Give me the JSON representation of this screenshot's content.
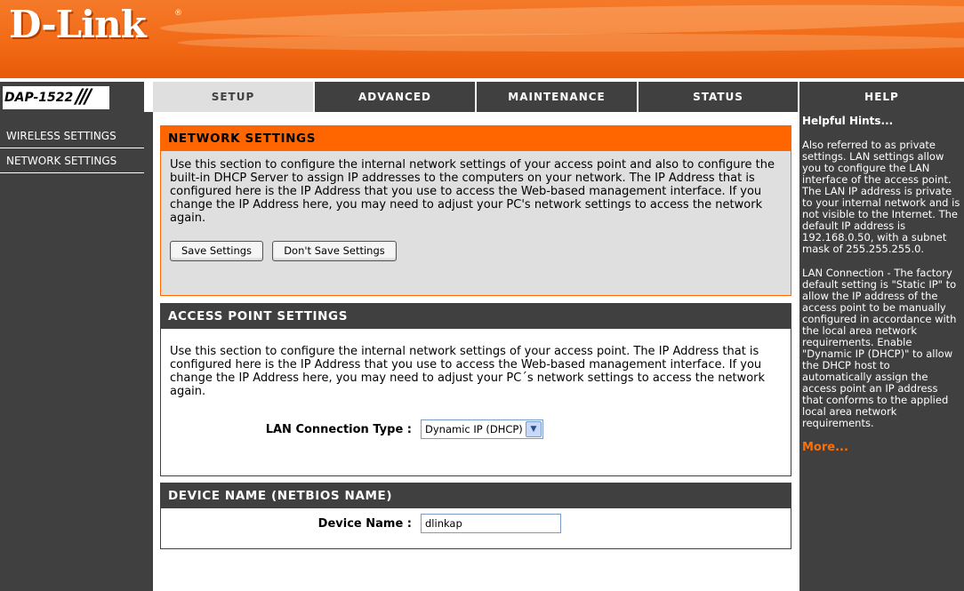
{
  "brand": {
    "logo": "D-Link",
    "reg": "®",
    "model": "DAP-1522",
    "slashes": "///"
  },
  "tabs": [
    {
      "label": "SETUP"
    },
    {
      "label": "ADVANCED"
    },
    {
      "label": "MAINTENANCE"
    },
    {
      "label": "STATUS"
    },
    {
      "label": "HELP"
    }
  ],
  "sidebar": {
    "items": [
      {
        "label": "WIRELESS SETTINGS"
      },
      {
        "label": "NETWORK SETTINGS"
      }
    ]
  },
  "network": {
    "title": "NETWORK SETTINGS",
    "description": "Use this section to configure the internal network settings of your access point and also to configure the built-in DHCP Server to assign IP addresses to the computers on your network. The IP Address that is configured here is the IP Address that you use to access the Web-based management interface. If you change the IP Address here, you may need to adjust your PC's network settings to access the network again.",
    "save_label": "Save Settings",
    "dont_save_label": "Don't Save Settings"
  },
  "ap": {
    "title": "ACCESS POINT SETTINGS",
    "description": "Use this section to configure the internal network settings of your access point. The IP Address that is configured here is the IP Address that you use to access the Web-based management interface. If you change the IP Address here, you may need to adjust your PC´s network settings to access the network again.",
    "lan_label": "LAN Connection Type :",
    "lan_value": "Dynamic IP (DHCP)"
  },
  "device": {
    "title": "DEVICE NAME (NETBIOS NAME)",
    "name_label": "Device Name :",
    "name_value": "dlinkap"
  },
  "help": {
    "title": "Helpful Hints...",
    "p1": "Also referred to as private settings. LAN settings allow you to configure the LAN interface of the access point. The LAN IP address is private to your internal network and is not visible to the Internet. The default IP address is 192.168.0.50, with a subnet mask of 255.255.255.0.",
    "p2": "LAN Connection - The factory default setting is \"Static IP\" to allow the IP address of the access point to be manually configured in accordance with the local area network requirements. Enable \"Dynamic IP (DHCP)\" to allow the DHCP host to automatically assign the access point an IP address that conforms to the applied local area network requirements.",
    "more": "More..."
  }
}
